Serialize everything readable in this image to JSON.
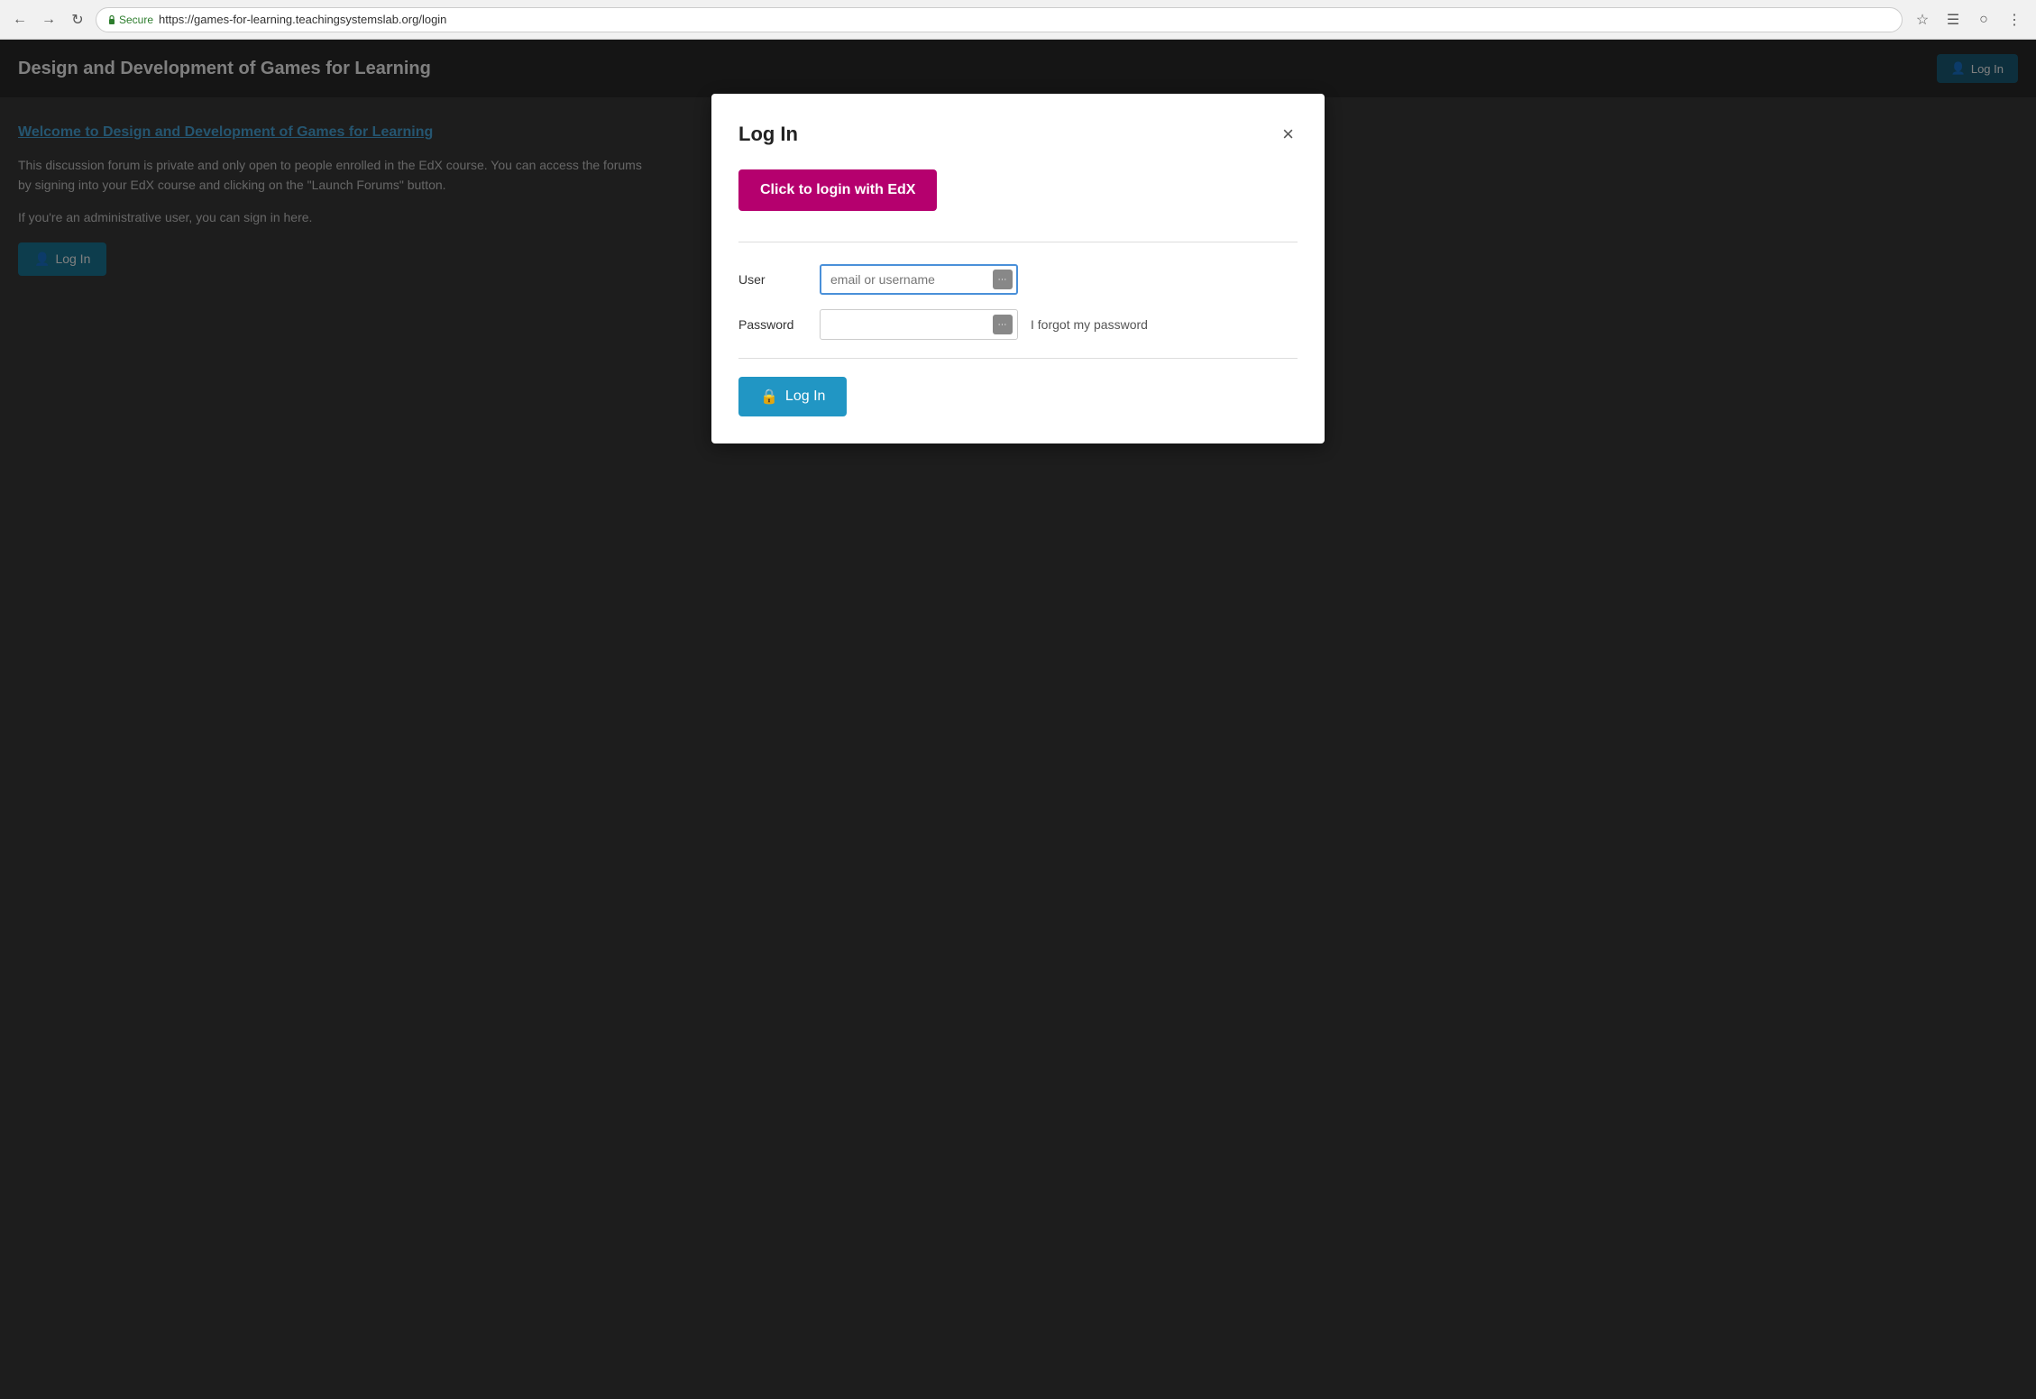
{
  "browser": {
    "url_secure_label": "Secure",
    "url": "https://games-for-learning.teachingsystemslab.org/login",
    "back_title": "Back",
    "forward_title": "Forward",
    "reload_title": "Reload"
  },
  "site": {
    "title": "Design and Development of Games for Learning",
    "header_login_label": "Log In"
  },
  "page": {
    "welcome_link": "Welcome to Design and Development of Games for Learning",
    "description1": "This discussion forum is private and only open to people enrolled in the EdX course. You can access the forums by signing into your EdX course and clicking on the \"Launch Forums\" button.",
    "description2": "If you're an administrative user, you can sign in here.",
    "login_button_label": "Log In"
  },
  "modal": {
    "title": "Log In",
    "close_label": "×",
    "edx_button_label": "Click to login with EdX",
    "user_label": "User",
    "user_placeholder": "email or username",
    "password_label": "Password",
    "password_placeholder": "",
    "forgot_password_label": "I forgot my password",
    "login_button_label": "Log In"
  }
}
